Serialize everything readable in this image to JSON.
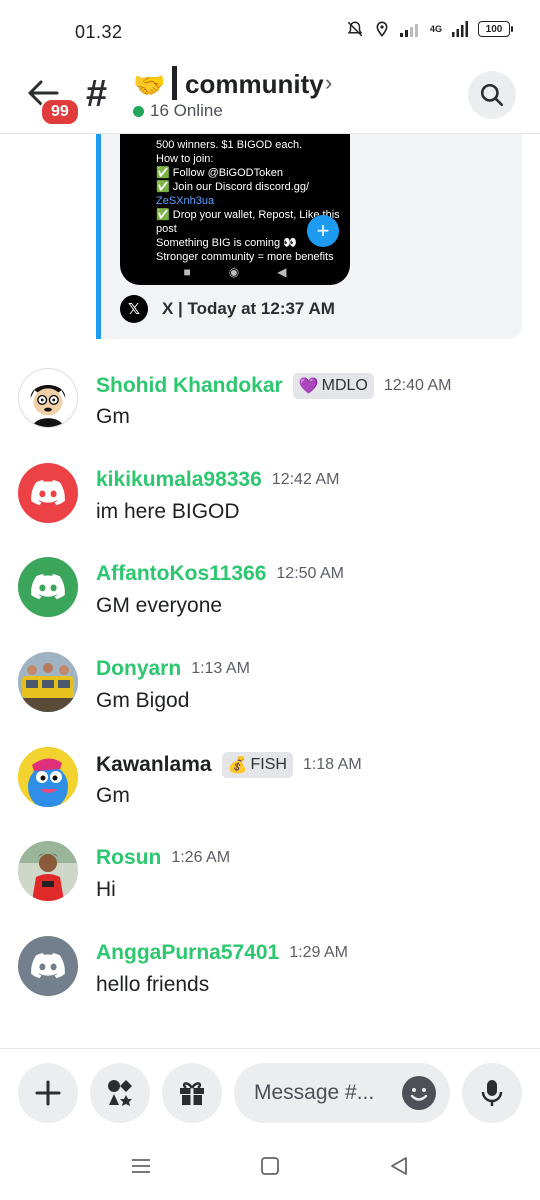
{
  "status": {
    "time": "01.32",
    "signal_label": "4G",
    "battery": "100"
  },
  "header": {
    "unread_badge": "99",
    "channel_emoji": "🤝",
    "channel_name": "community",
    "online_text": "16 Online"
  },
  "embed": {
    "image_lines": [
      "500 winners. $1 BIGOD each.",
      "How to join:",
      "✅ Follow @BiGODToken",
      "✅ Join our Discord discord.gg/",
      "ZeSXnh3ua",
      "✅ Drop your wallet, Repost, Like this",
      "post",
      "Something BIG is coming 👀",
      "Stronger community = more benefits"
    ],
    "footer": "X | Today at 12:37 AM",
    "x_logo": "𝕏"
  },
  "messages": [
    {
      "user": "Shohid Khandokar",
      "tag": "MDLO",
      "tag_icon": "💜",
      "time": "12:40 AM",
      "text": "Gm",
      "avatar": "cartoon-avatar",
      "name_color": "#2dc770"
    },
    {
      "user": "kikikumala98336",
      "tag": "",
      "time": "12:42 AM",
      "text": "im here BIGOD",
      "avatar": "discord-default-red",
      "name_color": "#2dc770"
    },
    {
      "user": "AffantoKos11366",
      "tag": "",
      "time": "12:50 AM",
      "text": "GM everyone",
      "avatar": "discord-default-green",
      "name_color": "#2dc770"
    },
    {
      "user": "Donyarn",
      "tag": "",
      "time": "1:13 AM",
      "text": "Gm Bigod",
      "avatar": "photo-avatar",
      "name_color": "#2dc770"
    },
    {
      "user": "Kawanlama",
      "tag": "FISH",
      "tag_icon": "💰",
      "time": "1:18 AM",
      "text": "Gm",
      "avatar": "cartoon-bird",
      "name_color": "#1f2124"
    },
    {
      "user": "Rosun",
      "tag": "",
      "time": "1:26 AM",
      "text": "Hi",
      "avatar": "photo-avatar",
      "name_color": "#2dc770"
    },
    {
      "user": "AnggaPurna57401",
      "tag": "",
      "time": "1:29 AM",
      "text": "hello friends",
      "avatar": "discord-default-grey",
      "name_color": "#2dc770"
    }
  ],
  "composer": {
    "placeholder": "Message #..."
  },
  "colors": {
    "online": "#23a55a",
    "username_green": "#2dc770",
    "badge_red": "#e03c3c",
    "link_blue": "#1d9bf0"
  }
}
